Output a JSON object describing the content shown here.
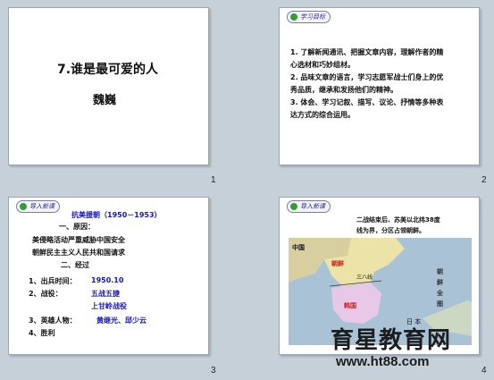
{
  "slide1": {
    "title": "7.谁是最可爱的人",
    "author": "魏巍",
    "number": "1"
  },
  "slide2": {
    "badge": "学习目标",
    "items": [
      "1. 了解新闻通讯、把握文章内容，理解作者的精",
      "心选材和巧妙组材。",
      "2. 品味文章的语言，学习志愿军战士们身上的优",
      "秀品质，继承和发扬他们的精神。",
      "3. 体会、学习记叙、描写、议论、抒情等多种表",
      "达方式的综合运用。"
    ],
    "number": "2"
  },
  "slide3": {
    "badge": "导入新课",
    "title": "抗美援朝（1950－1953）",
    "h1": "一、原因：",
    "r1": "美侵略活动严重威胁中国安全",
    "r2": "朝鲜民主主义人民共和国请求",
    "h2": "二、经过",
    "l1": "1、出兵时间：",
    "v1": "1950.10",
    "l2": "2、战役：",
    "v2a": "五战五捷",
    "v2b": "上甘岭战役",
    "l3": "3、英雄人物：",
    "v3": "黄继光、邱少云",
    "l4": "4、胜利",
    "number": "3"
  },
  "slide4": {
    "badge": "导入新课",
    "caption1": "二战结束后、苏美以北纬38度",
    "caption2": "线为界，分区占领朝鲜。",
    "map": {
      "china": "中国",
      "north": "朝鲜",
      "line": "三八线",
      "south": "韩国",
      "korea_full_1": "朝",
      "korea_full_2": "鲜",
      "korea_full_3": "全",
      "korea_full_4": "图",
      "japan": "日 本"
    },
    "number": "4"
  },
  "watermark": {
    "brand": "育星教育网",
    "url": "www.ht88.com"
  },
  "colors": {
    "background": "#c5d0d9",
    "accent_blue": "#1515c8",
    "map_sea": "#a9c2d6",
    "map_china": "#d8cfa0",
    "map_north": "#ece3a8",
    "map_south": "#e8c8e8",
    "label_red": "#d01818"
  }
}
